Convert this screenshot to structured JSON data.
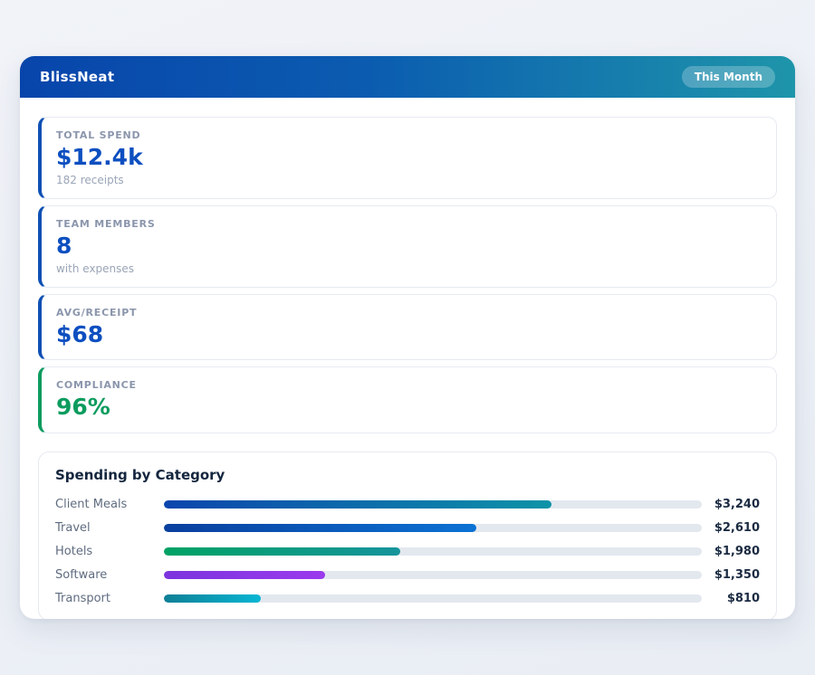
{
  "header": {
    "app_name": "BlissNeat",
    "period_badge": "This Month"
  },
  "stats": [
    {
      "label": "TOTAL SPEND",
      "value": "$12.4k",
      "sub": "182 receipts",
      "accent": "#0d50b4",
      "value_color": "#0d4fc0"
    },
    {
      "label": "TEAM MEMBERS",
      "value": "8",
      "sub": "with expenses",
      "accent": "#0d50b4",
      "value_color": "#0d4fc0"
    },
    {
      "label": "AVG/RECEIPT",
      "value": "$68",
      "sub": "",
      "accent": "#0d50b4",
      "value_color": "#0d4fc0"
    },
    {
      "label": "COMPLIANCE",
      "value": "96%",
      "sub": "",
      "accent": "#0d9b60",
      "value_color": "#0c9c5e"
    }
  ],
  "spending": {
    "title": "Spending by Category",
    "scale_max": 4500,
    "rows": [
      {
        "label": "Client Meals",
        "value": 3240,
        "value_label": "$3,240",
        "gradient": [
          "#0b45ad",
          "#0d93a8"
        ]
      },
      {
        "label": "Travel",
        "value": 2610,
        "value_label": "$2,610",
        "gradient": [
          "#0a3f9e",
          "#0b72d4"
        ]
      },
      {
        "label": "Hotels",
        "value": 1980,
        "value_label": "$1,980",
        "gradient": [
          "#00a264",
          "#16949c"
        ]
      },
      {
        "label": "Software",
        "value": 1350,
        "value_label": "$1,350",
        "gradient": [
          "#7b34dd",
          "#9b3bee"
        ]
      },
      {
        "label": "Transport",
        "value": 810,
        "value_label": "$810",
        "gradient": [
          "#0e7f96",
          "#06b6d4"
        ]
      }
    ]
  },
  "colors": {
    "header_gradient_start": "#0845ab",
    "header_gradient_end": "#1e95aa",
    "stat_accent_blue": "#0d50b4",
    "stat_accent_green": "#0d9b60",
    "track_background": "#e3e8ef"
  }
}
